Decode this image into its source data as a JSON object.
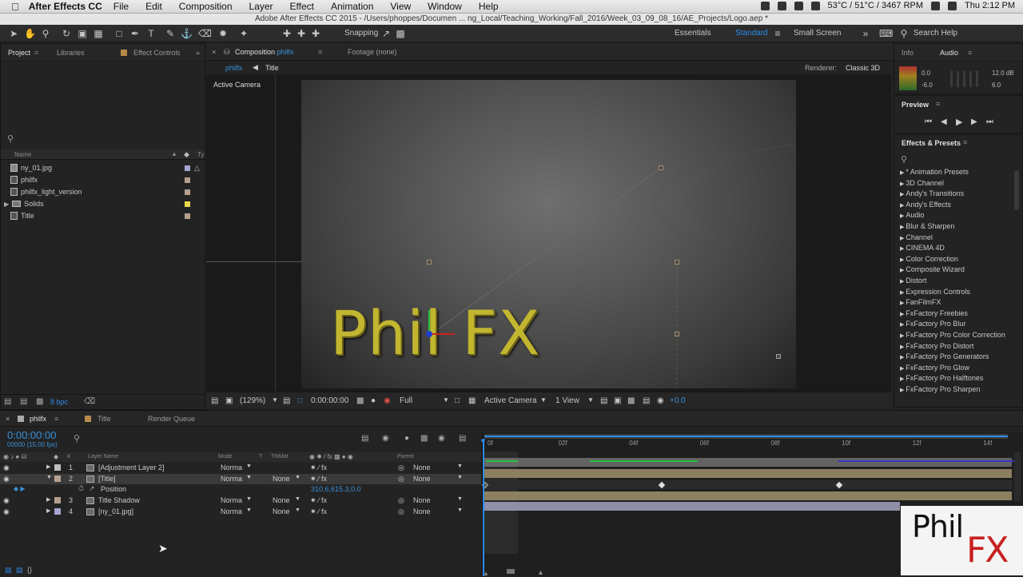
{
  "menubar": {
    "app_name": "After Effects CC",
    "menus": [
      "File",
      "Edit",
      "Composition",
      "Layer",
      "Effect",
      "Animation",
      "View",
      "Window",
      "Help"
    ],
    "status": "53°C / 51°C / 3467 RPM",
    "clock": "Thu 2:12 PM"
  },
  "window_title": "Adobe After Effects CC 2015 - /Users/phoppes/Documen ... ng_Local/Teaching_Working/Fall_2016/Week_03_09_08_16/AE_Projects/Logo.aep *",
  "toolbar": {
    "snapping_label": "Snapping",
    "workspaces": [
      "Essentials",
      "Standard",
      "Small Screen"
    ],
    "search_placeholder": "Search Help"
  },
  "project_panel": {
    "tabs": [
      "Project",
      "Libraries",
      "Effect Controls"
    ],
    "column_name": "Name",
    "column_type": "Ty",
    "items": [
      {
        "name": "ny_01.jpg",
        "color": "#a5a5d2"
      },
      {
        "name": "philfx",
        "color": "#b5a090"
      },
      {
        "name": "philfx_light_version",
        "color": "#b5a090"
      },
      {
        "name": "Solids",
        "color": "#e8d84a"
      },
      {
        "name": "Title",
        "color": "#b5a090"
      }
    ],
    "bpc": "8 bpc"
  },
  "composition_panel": {
    "tab_label": "Composition",
    "tab_comp": "philfx",
    "footage_label": "Footage (none)",
    "breadcrumbs": [
      "philfx",
      "Title"
    ],
    "renderer_label": "Renderer:",
    "renderer_value": "Classic 3D",
    "view_label": "Active Camera",
    "comp_text": "Phil FX",
    "magnification": "(129%)",
    "timecode": "0:00:00:00",
    "resolution": "Full",
    "camera": "Active Camera",
    "views": "1 View",
    "exposure": "+0.0"
  },
  "info_panel": {
    "tabs": [
      "Info",
      "Audio"
    ],
    "audio_left": [
      "0.0",
      "-6.0"
    ],
    "audio_right": [
      "12.0 dB",
      "6.0"
    ]
  },
  "preview_panel": {
    "title": "Preview"
  },
  "effects_panel": {
    "title": "Effects & Presets",
    "items": [
      "* Animation Presets",
      "3D Channel",
      "Andy's Transitions",
      "Andy's Effects",
      "Audio",
      "Blur & Sharpen",
      "Channel",
      "CINEMA 4D",
      "Color Correction",
      "Composite Wizard",
      "Distort",
      "Expression Controls",
      "FanFilmFX",
      "FxFactory Freebies",
      "FxFactory Pro Blur",
      "FxFactory Pro Color Correction",
      "FxFactory Pro Distort",
      "FxFactory Pro Generators",
      "FxFactory Pro Glow",
      "FxFactory Pro Halftones",
      "FxFactory Pro Sharpen"
    ]
  },
  "timeline": {
    "tabs": [
      "philfx",
      "Title",
      "Render Queue"
    ],
    "timecode": "0:00:00:00",
    "frame_info": "00000 (15.00 fps)",
    "columns": {
      "num": "#",
      "layer_name": "Layer Name",
      "mode": "Mode",
      "t": "T",
      "trkmat": "TrkMat",
      "parent": "Parent"
    },
    "ruler": [
      "0f",
      "02f",
      "04f",
      "06f",
      "08f",
      "10f",
      "12f",
      "14f"
    ],
    "layers": [
      {
        "num": "1",
        "name": "[Adjustment Layer 2]",
        "mode": "Norma",
        "trkmat": "",
        "parent": "None",
        "color": "#c0c0c0"
      },
      {
        "num": "2",
        "name": "[Title]",
        "mode": "Norma",
        "trkmat": "None",
        "parent": "None",
        "color": "#b5a090"
      },
      {
        "num": "3",
        "name": "Title Shadow",
        "mode": "Norma",
        "trkmat": "None",
        "parent": "None",
        "color": "#b5a090"
      },
      {
        "num": "4",
        "name": "[ny_01.jpg]",
        "mode": "Norma",
        "trkmat": "None",
        "parent": "None",
        "color": "#a5a5d2"
      }
    ],
    "property_name": "Position",
    "property_value": "310.6,615.3,0.0"
  },
  "watermark": {
    "text_top": "Phil",
    "text_bottom": "FX"
  }
}
